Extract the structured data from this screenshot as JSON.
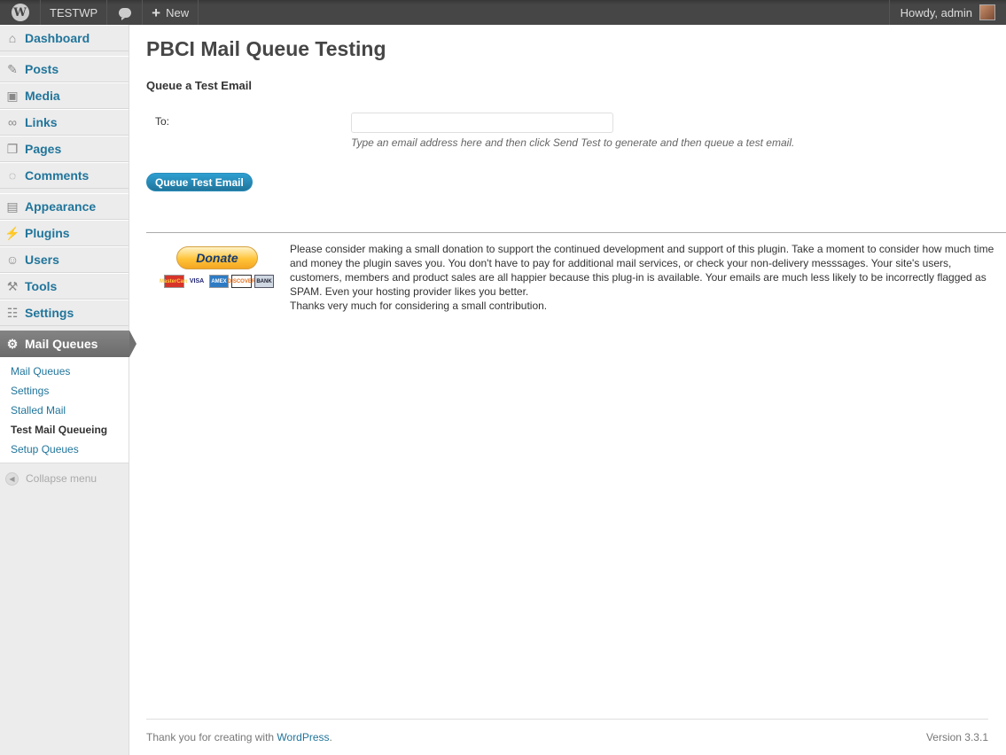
{
  "adminbar": {
    "site_name": "TESTWP",
    "new_label": "New",
    "greeting": "Howdy, admin"
  },
  "sidebar": {
    "items": [
      {
        "label": "Dashboard",
        "icon": "dashboard-icon"
      },
      {
        "label": "Posts",
        "icon": "pin-icon"
      },
      {
        "label": "Media",
        "icon": "media-icon"
      },
      {
        "label": "Links",
        "icon": "link-icon"
      },
      {
        "label": "Pages",
        "icon": "pages-icon"
      },
      {
        "label": "Comments",
        "icon": "comments-icon"
      },
      {
        "label": "Appearance",
        "icon": "appearance-icon"
      },
      {
        "label": "Plugins",
        "icon": "plugins-icon"
      },
      {
        "label": "Users",
        "icon": "users-icon"
      },
      {
        "label": "Tools",
        "icon": "tools-icon"
      },
      {
        "label": "Settings",
        "icon": "settings-icon"
      }
    ],
    "current": {
      "label": "Mail Queues",
      "icon": "gear-icon"
    },
    "submenu": [
      "Mail Queues",
      "Settings",
      "Stalled Mail",
      "Test Mail Queueing",
      "Setup Queues"
    ],
    "submenu_current": "Test Mail Queueing",
    "collapse_label": "Collapse menu"
  },
  "main": {
    "title": "PBCI Mail Queue Testing",
    "section_title": "Queue a Test Email",
    "to_label": "To:",
    "to_value": "",
    "to_description": "Type an email address here and then click Send Test to generate and then queue a test email.",
    "submit_label": "Queue Test Email",
    "donate_label": "Donate",
    "cards": [
      "MasterCard",
      "VISA",
      "AMEX",
      "DISCOVER",
      "BANK"
    ],
    "donate_text": "Please consider making a small donation to support the continued development and support of this plugin. Take a moment to consider how much time and money the plugin saves you. You don't have to pay for additional mail services, or check your non-delivery messsages. Your site's users, customers, members and product sales are all happier because this plug-in is available. Your emails are much less likely to be incorrectly flagged as SPAM. Even your hosting provider likes you better.",
    "donate_thanks": "Thanks very much for considering a small contribution."
  },
  "footer": {
    "thanks_prefix": "Thank you for creating with ",
    "link_label": "WordPress",
    "thanks_suffix": ".",
    "version": "Version 3.3.1"
  }
}
